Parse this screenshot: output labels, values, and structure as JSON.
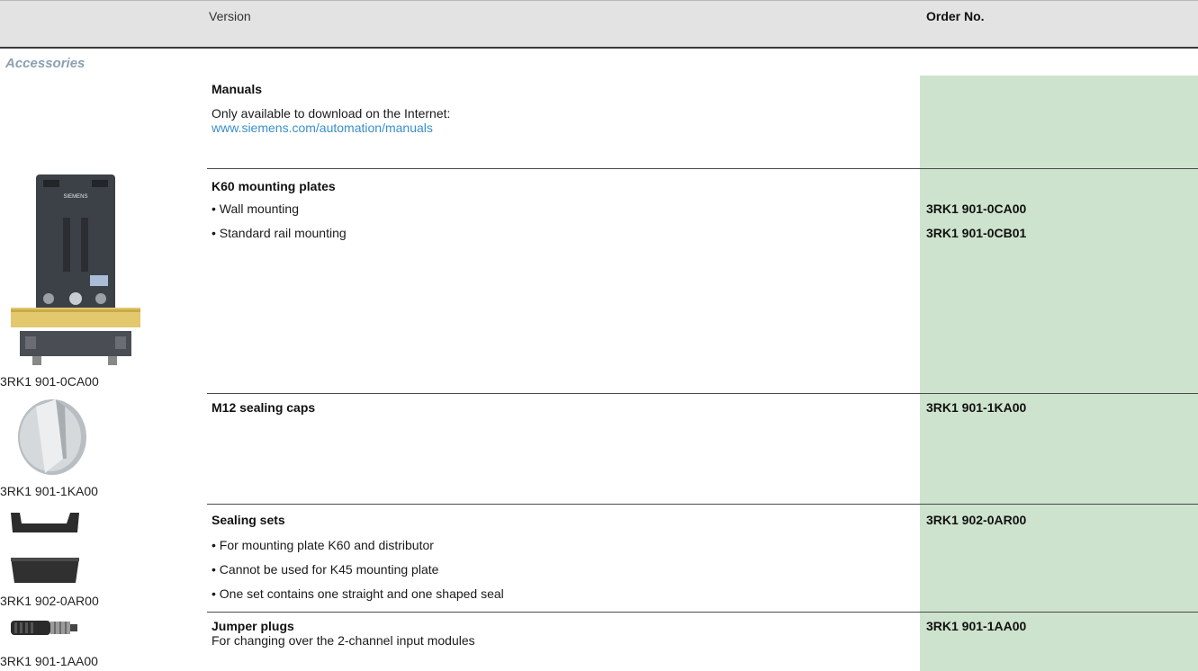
{
  "header": {
    "version": "Version",
    "order_no": "Order No."
  },
  "section": {
    "title": "Accessories"
  },
  "manuals": {
    "title": "Manuals",
    "text": "Only available to download on the Internet:",
    "link": "www.siemens.com/automation/manuals"
  },
  "k60": {
    "title": "K60 mounting plates",
    "items": [
      {
        "label": "Wall mounting",
        "order": "3RK1 901-0CA00"
      },
      {
        "label": "Standard rail mounting",
        "order": "3RK1 901-0CB01"
      }
    ],
    "image_caption": "3RK1 901-0CA00",
    "image_logo_text": "SIEMENS"
  },
  "m12": {
    "title": "M12 sealing caps",
    "order": "3RK1 901-1KA00",
    "image_caption": "3RK1 901-1KA00"
  },
  "sealing": {
    "title": "Sealing sets",
    "order": "3RK1 902-0AR00",
    "bullets": [
      "For mounting plate K60 and distributor",
      "Cannot be used for K45 mounting plate",
      "One set contains one straight and one shaped seal"
    ],
    "image_caption": "3RK1 902-0AR00"
  },
  "jumper": {
    "title": "Jumper plugs",
    "text": "For changing over the 2-channel input modules",
    "order": "3RK1 901-1AA00",
    "image_caption": "3RK1 901-1AA00"
  }
}
